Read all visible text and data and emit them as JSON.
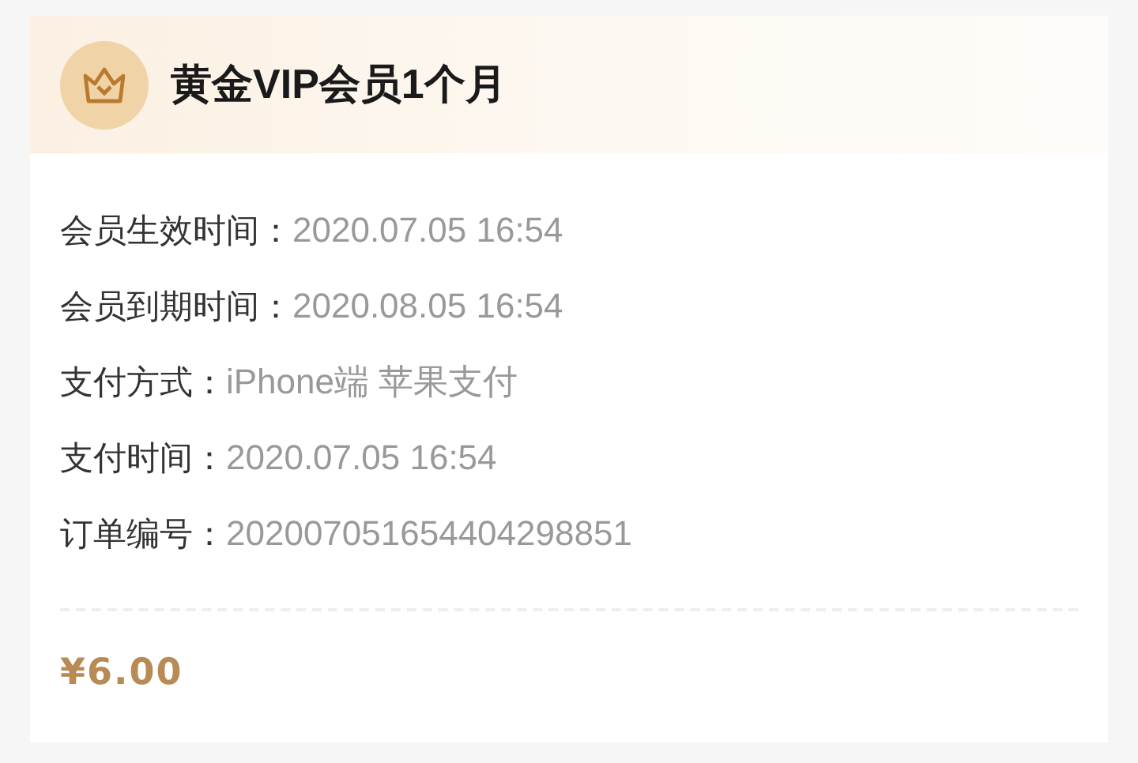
{
  "header": {
    "title": "黄金VIP会员1个月"
  },
  "details": [
    {
      "label": "会员生效时间：",
      "value": "2020.07.05 16:54"
    },
    {
      "label": "会员到期时间：",
      "value": "2020.08.05 16:54"
    },
    {
      "label": "支付方式：",
      "value": "iPhone端 苹果支付"
    },
    {
      "label": "支付时间：",
      "value": "2020.07.05 16:54"
    },
    {
      "label": "订单编号：",
      "value": "202007051654404298851"
    }
  ],
  "price": "¥6.00"
}
